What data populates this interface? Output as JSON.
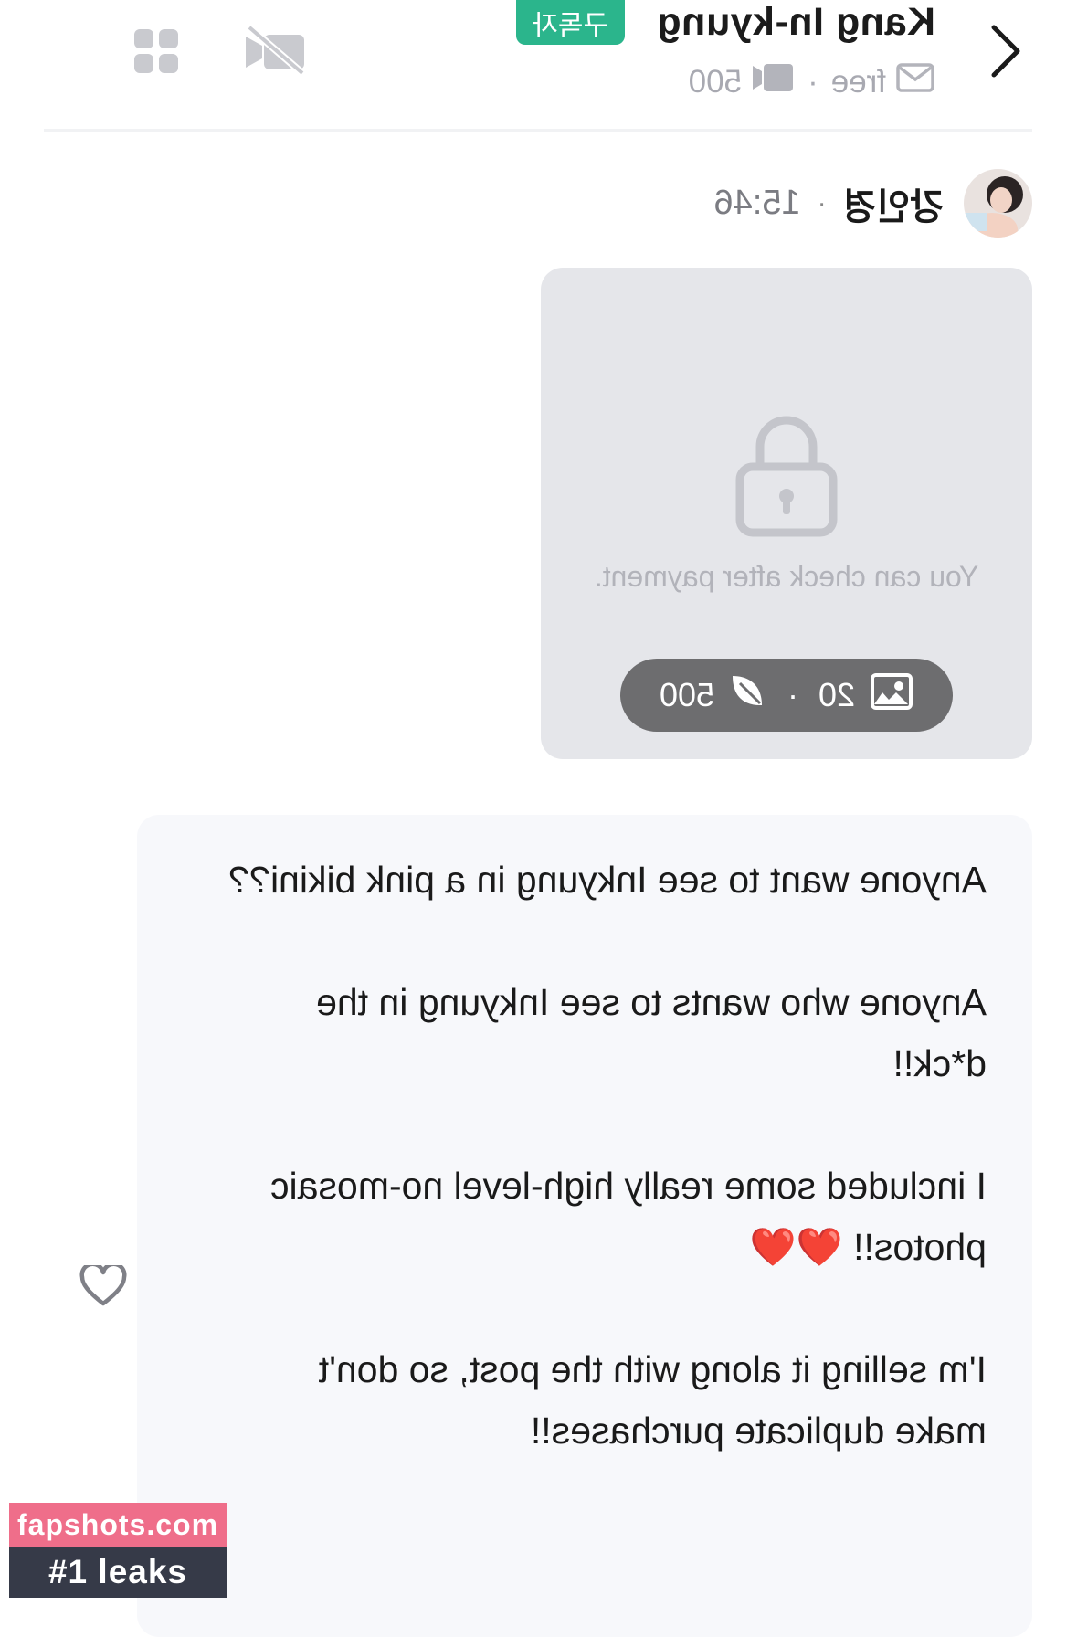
{
  "header": {
    "creator_name": "Kang In-kyung",
    "badge": "구독자",
    "meta": {
      "plan": "free",
      "media_count": "500"
    },
    "back_icon": "chevron-right-icon",
    "actions": [
      "video-off-icon",
      "grid-icon"
    ]
  },
  "post": {
    "author": "강인경",
    "time": "15:46",
    "locked": {
      "message": "You can check after payment.",
      "image_count": "20",
      "price": "500"
    },
    "body": [
      "Anyone want to see Inkyung in a pink bikini??",
      "Anyone who wants to see Inkyung in the d*ck!!",
      "I included some really high-level no-mosaic photos!! ❤️❤️",
      "I'm selling it along with the post, so don't make duplicate purchases!!"
    ]
  },
  "watermark": {
    "site": "fapshots.com",
    "tagline": "#1 leaks"
  },
  "colors": {
    "badge": "#2bb58c",
    "pill": "#6d6d6f",
    "locked_bg": "#e5e6ea",
    "card_bg": "#f7f8fb"
  }
}
